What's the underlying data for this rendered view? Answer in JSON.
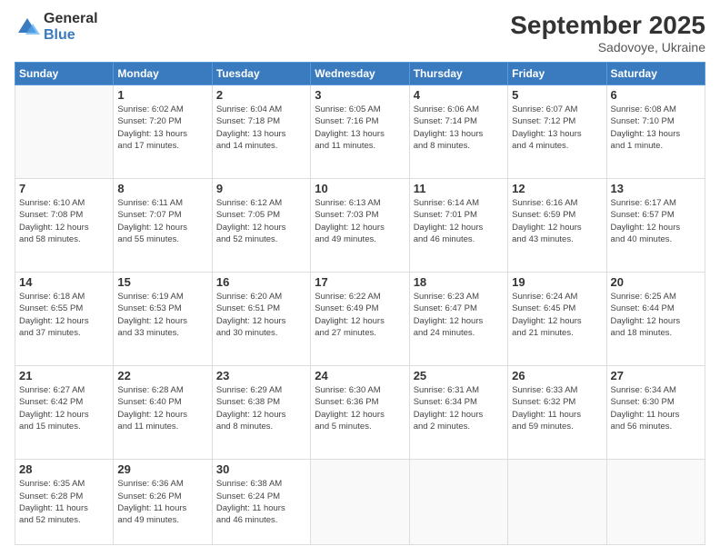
{
  "logo": {
    "general": "General",
    "blue": "Blue"
  },
  "header": {
    "month_year": "September 2025",
    "location": "Sadovoye, Ukraine"
  },
  "weekdays": [
    "Sunday",
    "Monday",
    "Tuesday",
    "Wednesday",
    "Thursday",
    "Friday",
    "Saturday"
  ],
  "weeks": [
    [
      {
        "day": "",
        "info": ""
      },
      {
        "day": "1",
        "info": "Sunrise: 6:02 AM\nSunset: 7:20 PM\nDaylight: 13 hours\nand 17 minutes."
      },
      {
        "day": "2",
        "info": "Sunrise: 6:04 AM\nSunset: 7:18 PM\nDaylight: 13 hours\nand 14 minutes."
      },
      {
        "day": "3",
        "info": "Sunrise: 6:05 AM\nSunset: 7:16 PM\nDaylight: 13 hours\nand 11 minutes."
      },
      {
        "day": "4",
        "info": "Sunrise: 6:06 AM\nSunset: 7:14 PM\nDaylight: 13 hours\nand 8 minutes."
      },
      {
        "day": "5",
        "info": "Sunrise: 6:07 AM\nSunset: 7:12 PM\nDaylight: 13 hours\nand 4 minutes."
      },
      {
        "day": "6",
        "info": "Sunrise: 6:08 AM\nSunset: 7:10 PM\nDaylight: 13 hours\nand 1 minute."
      }
    ],
    [
      {
        "day": "7",
        "info": "Sunrise: 6:10 AM\nSunset: 7:08 PM\nDaylight: 12 hours\nand 58 minutes."
      },
      {
        "day": "8",
        "info": "Sunrise: 6:11 AM\nSunset: 7:07 PM\nDaylight: 12 hours\nand 55 minutes."
      },
      {
        "day": "9",
        "info": "Sunrise: 6:12 AM\nSunset: 7:05 PM\nDaylight: 12 hours\nand 52 minutes."
      },
      {
        "day": "10",
        "info": "Sunrise: 6:13 AM\nSunset: 7:03 PM\nDaylight: 12 hours\nand 49 minutes."
      },
      {
        "day": "11",
        "info": "Sunrise: 6:14 AM\nSunset: 7:01 PM\nDaylight: 12 hours\nand 46 minutes."
      },
      {
        "day": "12",
        "info": "Sunrise: 6:16 AM\nSunset: 6:59 PM\nDaylight: 12 hours\nand 43 minutes."
      },
      {
        "day": "13",
        "info": "Sunrise: 6:17 AM\nSunset: 6:57 PM\nDaylight: 12 hours\nand 40 minutes."
      }
    ],
    [
      {
        "day": "14",
        "info": "Sunrise: 6:18 AM\nSunset: 6:55 PM\nDaylight: 12 hours\nand 37 minutes."
      },
      {
        "day": "15",
        "info": "Sunrise: 6:19 AM\nSunset: 6:53 PM\nDaylight: 12 hours\nand 33 minutes."
      },
      {
        "day": "16",
        "info": "Sunrise: 6:20 AM\nSunset: 6:51 PM\nDaylight: 12 hours\nand 30 minutes."
      },
      {
        "day": "17",
        "info": "Sunrise: 6:22 AM\nSunset: 6:49 PM\nDaylight: 12 hours\nand 27 minutes."
      },
      {
        "day": "18",
        "info": "Sunrise: 6:23 AM\nSunset: 6:47 PM\nDaylight: 12 hours\nand 24 minutes."
      },
      {
        "day": "19",
        "info": "Sunrise: 6:24 AM\nSunset: 6:45 PM\nDaylight: 12 hours\nand 21 minutes."
      },
      {
        "day": "20",
        "info": "Sunrise: 6:25 AM\nSunset: 6:44 PM\nDaylight: 12 hours\nand 18 minutes."
      }
    ],
    [
      {
        "day": "21",
        "info": "Sunrise: 6:27 AM\nSunset: 6:42 PM\nDaylight: 12 hours\nand 15 minutes."
      },
      {
        "day": "22",
        "info": "Sunrise: 6:28 AM\nSunset: 6:40 PM\nDaylight: 12 hours\nand 11 minutes."
      },
      {
        "day": "23",
        "info": "Sunrise: 6:29 AM\nSunset: 6:38 PM\nDaylight: 12 hours\nand 8 minutes."
      },
      {
        "day": "24",
        "info": "Sunrise: 6:30 AM\nSunset: 6:36 PM\nDaylight: 12 hours\nand 5 minutes."
      },
      {
        "day": "25",
        "info": "Sunrise: 6:31 AM\nSunset: 6:34 PM\nDaylight: 12 hours\nand 2 minutes."
      },
      {
        "day": "26",
        "info": "Sunrise: 6:33 AM\nSunset: 6:32 PM\nDaylight: 11 hours\nand 59 minutes."
      },
      {
        "day": "27",
        "info": "Sunrise: 6:34 AM\nSunset: 6:30 PM\nDaylight: 11 hours\nand 56 minutes."
      }
    ],
    [
      {
        "day": "28",
        "info": "Sunrise: 6:35 AM\nSunset: 6:28 PM\nDaylight: 11 hours\nand 52 minutes."
      },
      {
        "day": "29",
        "info": "Sunrise: 6:36 AM\nSunset: 6:26 PM\nDaylight: 11 hours\nand 49 minutes."
      },
      {
        "day": "30",
        "info": "Sunrise: 6:38 AM\nSunset: 6:24 PM\nDaylight: 11 hours\nand 46 minutes."
      },
      {
        "day": "",
        "info": ""
      },
      {
        "day": "",
        "info": ""
      },
      {
        "day": "",
        "info": ""
      },
      {
        "day": "",
        "info": ""
      }
    ]
  ]
}
